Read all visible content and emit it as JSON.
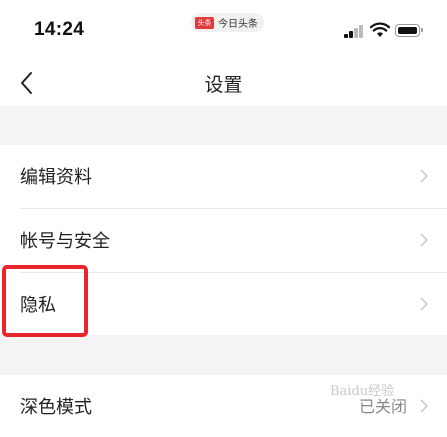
{
  "status_bar": {
    "time": "14:24",
    "app_name": "今日头条",
    "app_logo_text": "头条"
  },
  "nav": {
    "title": "设置"
  },
  "menu": {
    "group1": [
      {
        "label": "编辑资料"
      },
      {
        "label": "帐号与安全"
      },
      {
        "label": "隐私"
      }
    ],
    "group2": [
      {
        "label": "深色模式",
        "value": "已关闭"
      }
    ]
  },
  "watermark": {
    "text": "Baidu经验"
  },
  "colors": {
    "highlight": "#e8262b",
    "background": "#f4f4f4",
    "divider": "#eaeaea",
    "chevron": "#c2c2c2"
  }
}
